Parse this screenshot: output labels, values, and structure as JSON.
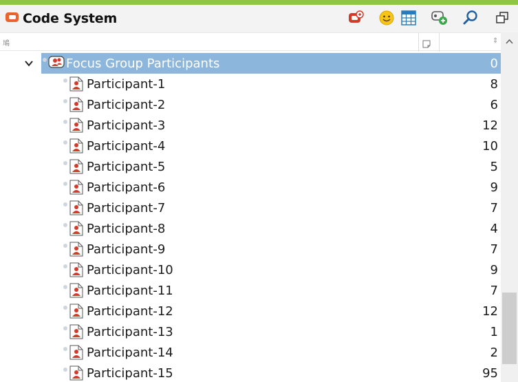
{
  "window": {
    "title": "Code System",
    "accent_color": "#8dc63f",
    "icons": [
      "code-system-icon",
      "filter-codes-icon",
      "smiley-icon",
      "table-icon",
      "new-code-icon",
      "search-icon",
      "undock-icon"
    ]
  },
  "column_header": {
    "tree_glyph": "鳩",
    "memo_icon": "memo-icon",
    "sort_icon": "sort-icon"
  },
  "tree": {
    "parent": {
      "label": "Focus Group Participants",
      "count": "0",
      "expanded": true,
      "selected": true
    },
    "children": [
      {
        "label": "Participant-1",
        "count": "8"
      },
      {
        "label": "Participant-2",
        "count": "6"
      },
      {
        "label": "Participant-3",
        "count": "12"
      },
      {
        "label": "Participant-4",
        "count": "10"
      },
      {
        "label": "Participant-5",
        "count": "5"
      },
      {
        "label": "Participant-6",
        "count": "9"
      },
      {
        "label": "Participant-7",
        "count": "7"
      },
      {
        "label": "Participant-8",
        "count": "4"
      },
      {
        "label": "Participant-9",
        "count": "7"
      },
      {
        "label": "Participant-10",
        "count": "9"
      },
      {
        "label": "Participant-11",
        "count": "7"
      },
      {
        "label": "Participant-12",
        "count": "12"
      },
      {
        "label": "Participant-13",
        "count": "1"
      },
      {
        "label": "Participant-14",
        "count": "2"
      },
      {
        "label": "Participant-15",
        "count": "95"
      }
    ]
  },
  "colors": {
    "selection": "#8cb6dc",
    "code_icon_red": "#d23a2a"
  }
}
